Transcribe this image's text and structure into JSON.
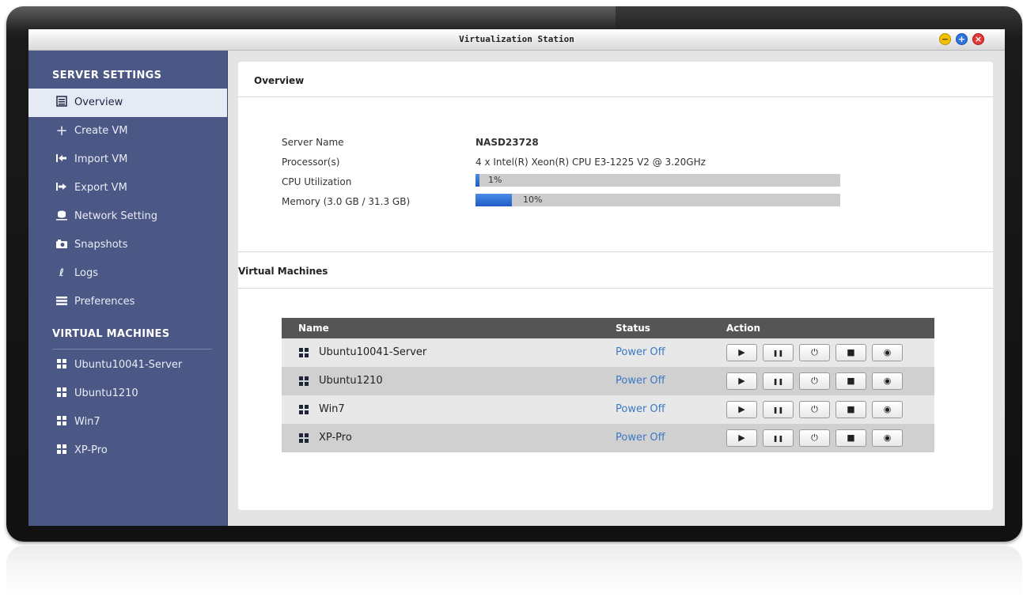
{
  "window": {
    "title": "Virtualization Station"
  },
  "sidebar": {
    "server_settings_heading": "SERVER SETTINGS",
    "items": [
      {
        "label": "Overview",
        "icon": "overview-icon",
        "active": true
      },
      {
        "label": "Create VM",
        "icon": "plus-icon"
      },
      {
        "label": "Import VM",
        "icon": "import-icon"
      },
      {
        "label": "Export VM",
        "icon": "export-icon"
      },
      {
        "label": "Network Setting",
        "icon": "network-icon"
      },
      {
        "label": "Snapshots",
        "icon": "camera-icon"
      },
      {
        "label": "Logs",
        "icon": "logs-icon"
      },
      {
        "label": "Preferences",
        "icon": "menu-icon"
      }
    ],
    "virtual_machines_heading": "VIRTUAL MACHINES",
    "vms": [
      {
        "label": "Ubuntu10041-Server"
      },
      {
        "label": "Ubuntu1210"
      },
      {
        "label": "Win7"
      },
      {
        "label": "XP-Pro"
      }
    ]
  },
  "overview": {
    "title": "Overview",
    "server_name_label": "Server Name",
    "server_name": "NASD23728",
    "processor_label": "Processor(s)",
    "processor": "4 x Intel(R) Xeon(R) CPU E3-1225 V2 @ 3.20GHz",
    "cpu_label": "CPU Utilization",
    "cpu_text": "1%",
    "cpu_fraction": 0.01,
    "memory_label": "Memory (3.0 GB / 31.3 GB)",
    "memory_text": "10%",
    "memory_fraction": 0.1
  },
  "virtual_machines": {
    "title": "Virtual Machines",
    "columns": {
      "name": "Name",
      "status": "Status",
      "action": "Action"
    },
    "rows": [
      {
        "name": "Ubuntu10041-Server",
        "status": "Power Off"
      },
      {
        "name": "Ubuntu1210",
        "status": "Power Off"
      },
      {
        "name": "Win7",
        "status": "Power Off"
      },
      {
        "name": "XP-Pro",
        "status": "Power Off"
      }
    ],
    "actions": {
      "play": "▶",
      "pause": "❚❚",
      "power": "⏻",
      "stop": "■",
      "view": "◉"
    }
  },
  "colors": {
    "sidebar": "#4b5784",
    "active_item": "#e6eaf5",
    "table_header": "#555555",
    "status_text": "#3c79c4",
    "bar_fill": "#1f5cc8"
  }
}
